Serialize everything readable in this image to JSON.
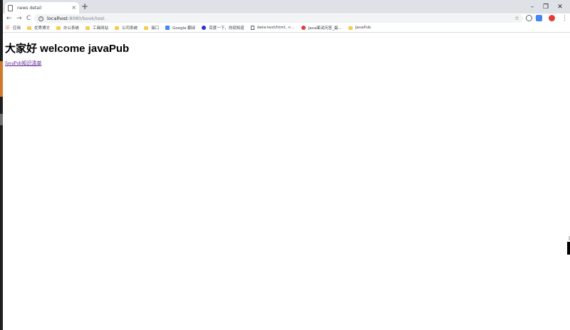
{
  "browser": {
    "tab": {
      "title": "news detail",
      "close": "×"
    },
    "newtab": "+",
    "window_controls": {
      "minimize": "–",
      "restore": "❐",
      "close": "✕"
    },
    "nav": {
      "back": "←",
      "forward": "→",
      "reload": "C"
    },
    "address": {
      "host": "localhost",
      "path": ":8080/book/test"
    },
    "star": "☆",
    "colors": {
      "ext_gray": "#5f6368",
      "ext_blue": "#4285f4",
      "ext_red": "#e53935"
    }
  },
  "bookmarks": [
    {
      "label": "应用",
      "icon": "apps-icon"
    },
    {
      "label": "优秀博文",
      "icon": "folder-icon"
    },
    {
      "label": "办公系统",
      "icon": "folder-icon"
    },
    {
      "label": "工具网站",
      "icon": "folder-icon"
    },
    {
      "label": "公司系统",
      "icon": "folder-icon"
    },
    {
      "label": "接口",
      "icon": "folder-icon"
    },
    {
      "label": "Google 翻译",
      "icon": "translate-icon"
    },
    {
      "label": "百度一下，你就知道",
      "icon": "baidu-icon"
    },
    {
      "label": "data:text/html, <...",
      "icon": "page-icon"
    },
    {
      "label": "Java面试问答_最...",
      "icon": "red-icon"
    },
    {
      "label": "JavaPub",
      "icon": "folder-icon"
    }
  ],
  "page": {
    "heading": "大家好 welcome javaPub",
    "link": "JavaPub知识清单",
    "link_color": "#551a8b"
  }
}
